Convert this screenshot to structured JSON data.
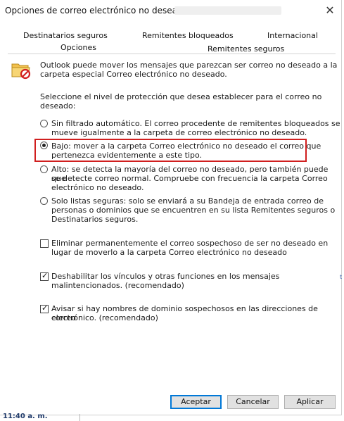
{
  "dialog": {
    "title": "Opciones de correo electrónico no deseado:",
    "close_symbol": "✕"
  },
  "tabs": {
    "row1": [
      "Destinatarios seguros",
      "Remitentes bloqueados",
      "Internacional"
    ],
    "row2": [
      "Opciones",
      "Remitentes seguros"
    ],
    "active": "Opciones"
  },
  "intro_text": {
    "line1": "Outlook puede mover los mensajes que parezcan ser correo no deseado a la",
    "line2": "carpeta especial Correo electrónico no deseado."
  },
  "level_prompt": {
    "line1": "Seleccione el nivel de protección que desea establecer para el correo no",
    "line2": "deseado:"
  },
  "radio_options": [
    {
      "checked": false,
      "lines": [
        "Sin filtrado automático. El correo procedente de remitentes bloqueados se",
        "mueve igualmente a la carpeta de correo electrónico no deseado."
      ]
    },
    {
      "checked": true,
      "lines": [
        "Bajo: mover a la carpeta Correo electrónico no deseado el correo que",
        "pertenezca evidentemente a este tipo."
      ]
    },
    {
      "checked": false,
      "lines": [
        "Alto: se detecta la mayoría del correo no deseado, pero también puede que",
        "se detecte correo normal. Compruebe con frecuencia la carpeta Correo",
        "electrónico no deseado."
      ]
    },
    {
      "checked": false,
      "lines": [
        "Solo listas seguras: solo se enviará a su Bandeja de entrada correo de",
        "personas o dominios que se encuentren en su lista Remitentes seguros o",
        "Destinatarios seguros."
      ]
    }
  ],
  "checkboxes": [
    {
      "checked": false,
      "lines": [
        "Eliminar permanentemente el correo sospechoso de ser no deseado en",
        "lugar de moverlo a la carpeta Correo electrónico no deseado"
      ]
    },
    {
      "checked": true,
      "lines": [
        "Deshabilitar los vínculos y otras funciones en los mensajes",
        "malintencionados. (recomendado)"
      ]
    },
    {
      "checked": true,
      "lines": [
        "Avisar si hay nombres de dominio sospechosos en las direcciones de correo",
        "electrónico. (recomendado)"
      ]
    }
  ],
  "check_symbol": "✓",
  "buttons": {
    "accept": "Aceptar",
    "cancel": "Cancelar",
    "apply": "Aplicar"
  },
  "taskbar": {
    "clock": "11:40 a. m."
  },
  "background_fragment": "t",
  "colors": {
    "highlight": "#d01f1f",
    "primary_button_border": "#0078d7"
  },
  "icons": {
    "info": "junk-mail-folder-icon"
  }
}
